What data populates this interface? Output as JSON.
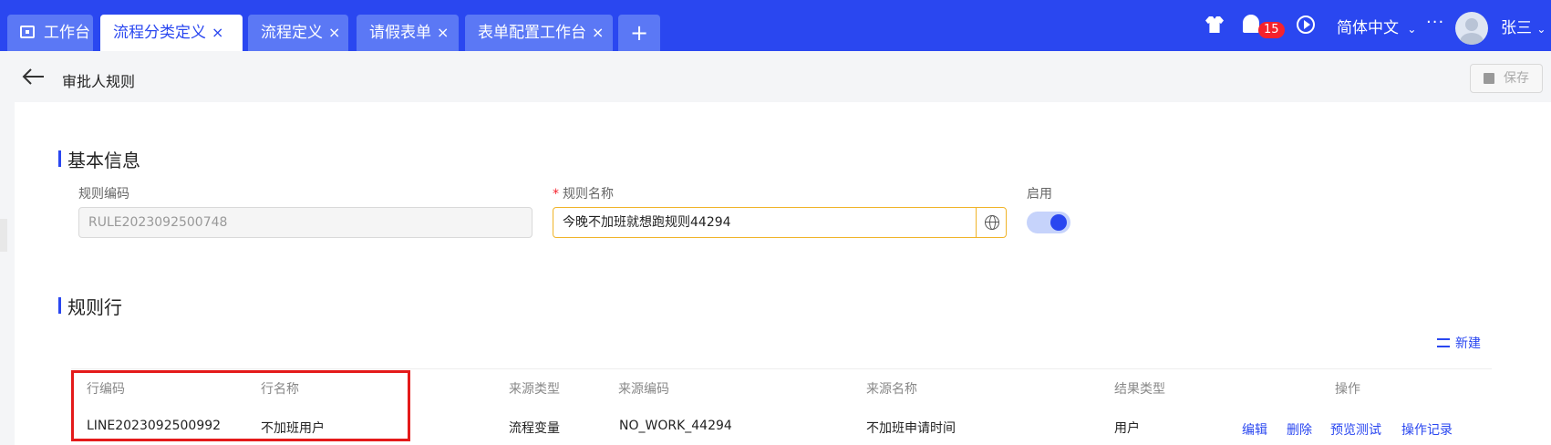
{
  "tabs": [
    {
      "label": "工作台",
      "closable": false,
      "active": false,
      "icon": "monitor-icon"
    },
    {
      "label": "流程分类定义",
      "closable": true,
      "active": true
    },
    {
      "label": "流程定义",
      "closable": true,
      "active": false
    },
    {
      "label": "请假表单",
      "closable": true,
      "active": false
    },
    {
      "label": "表单配置工作台",
      "closable": true,
      "active": false
    }
  ],
  "tab_close_glyph": "×",
  "tab_add_glyph": "+",
  "topbar": {
    "notification_count": "15",
    "language": "简体中文",
    "more": "···",
    "username": "张三"
  },
  "header": {
    "title": "审批人规则",
    "save_label": "保存"
  },
  "basic_info": {
    "section_title": "基本信息",
    "rule_code_label": "规则编码",
    "rule_code_value": "RULE2023092500748",
    "rule_name_label": "规则名称",
    "rule_name_required_mark": "*",
    "rule_name_value": "今晚不加班就想跑规则44294",
    "enabled_label": "启用",
    "enabled": true
  },
  "rule_lines": {
    "section_title": "规则行",
    "new_label": "新建",
    "columns": [
      "行编码",
      "行名称",
      "来源类型",
      "来源编码",
      "来源名称",
      "结果类型",
      "操作"
    ],
    "rows": [
      {
        "code": "LINE2023092500992",
        "name": "不加班用户",
        "source_type": "流程变量",
        "source_code": "NO_WORK_44294",
        "source_name": "不加班申请时间",
        "result_type": "用户",
        "actions": [
          "编辑",
          "删除",
          "预览测试",
          "操作记录"
        ]
      }
    ]
  },
  "colors": {
    "topbar": "#2a47f0",
    "accent": "#2a47f0",
    "highlight": "#e41a1a",
    "focus_border": "#f0b429"
  }
}
